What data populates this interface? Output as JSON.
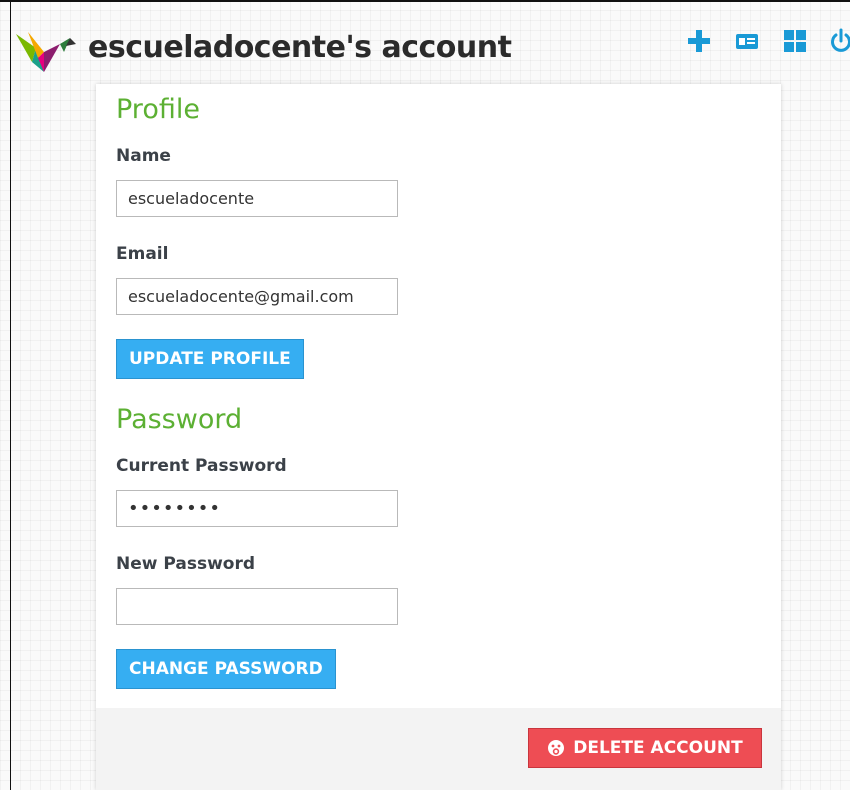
{
  "header": {
    "title": "escueladocente's account",
    "toolbar_icons": [
      "plus-icon",
      "id-card-icon",
      "grid-icon",
      "power-icon"
    ],
    "icon_color": "#1a9ad6"
  },
  "profile": {
    "title": "Profile",
    "name_label": "Name",
    "name_value": "escueladocente",
    "email_label": "Email",
    "email_value": "escueladocente@gmail.com",
    "update_button": "UPDATE PROFILE"
  },
  "password": {
    "title": "Password",
    "current_label": "Current Password",
    "current_value": "••••••••",
    "new_label": "New Password",
    "new_value": "",
    "change_button": "CHANGE PASSWORD"
  },
  "footer": {
    "delete_button": "DELETE ACCOUNT",
    "delete_icon": "sad-face-icon"
  },
  "colors": {
    "accent_green": "#5cb033",
    "button_blue": "#36aef2",
    "danger_red": "#ee4d54"
  }
}
